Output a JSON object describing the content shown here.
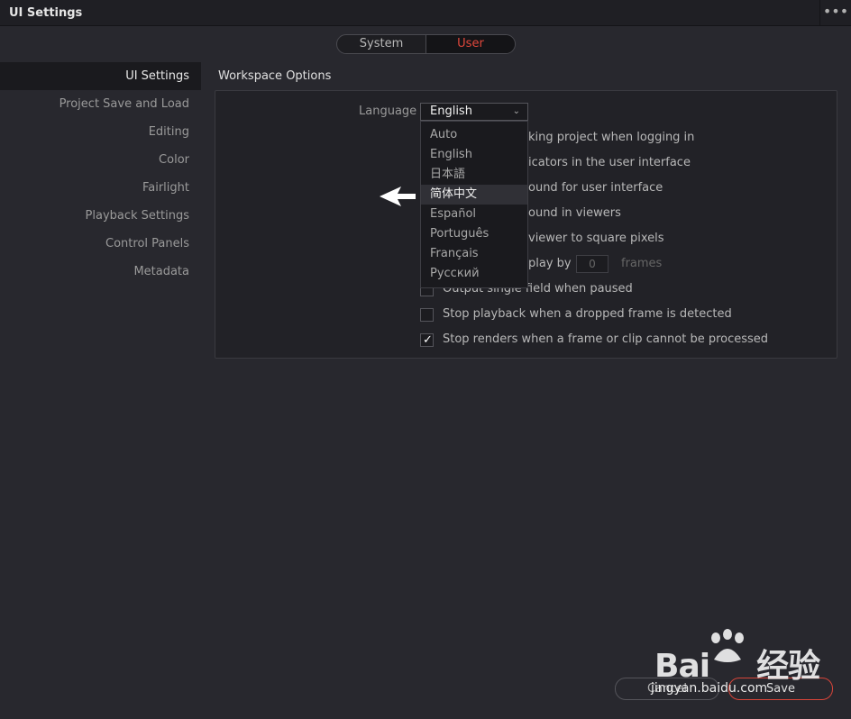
{
  "window": {
    "title": "UI Settings",
    "menu_glyph": "•••"
  },
  "segment": {
    "system": "System",
    "user": "User",
    "active": "User"
  },
  "sidebar": {
    "items": [
      {
        "label": "UI Settings",
        "active": true
      },
      {
        "label": "Project Save and Load",
        "active": false
      },
      {
        "label": "Editing",
        "active": false
      },
      {
        "label": "Color",
        "active": false
      },
      {
        "label": "Fairlight",
        "active": false
      },
      {
        "label": "Playback Settings",
        "active": false
      },
      {
        "label": "Control Panels",
        "active": false
      },
      {
        "label": "Metadata",
        "active": false
      }
    ]
  },
  "workspace": {
    "title": "Workspace Options",
    "language_label": "Language",
    "language_value": "English",
    "language_options": [
      "Auto",
      "English",
      "日本語",
      "简体中文",
      "Español",
      "Português",
      "Français",
      "Русский"
    ],
    "highlighted_option": "简体中文",
    "options_partial": [
      "king project when logging in",
      "icators in the user interface",
      "ound for user interface",
      "ound in viewers",
      "viewer to square pixels",
      "play by"
    ],
    "display_delay_value": "0",
    "display_delay_unit": "frames",
    "output_single_field": "Output single field when paused",
    "stop_playback": "Stop playback when a dropped frame is detected",
    "stop_renders": "Stop renders when a frame or clip cannot be processed",
    "stop_playback_checked": false,
    "stop_renders_checked": true
  },
  "buttons": {
    "cancel": "Cancel",
    "save": "Save"
  },
  "watermark": {
    "brand_left": "Bai",
    "brand_right": "经验",
    "url": "jingyan.baidu.com"
  },
  "colors": {
    "accent_red": "#e2483c",
    "background": "#28282e",
    "panel": "#222227"
  }
}
